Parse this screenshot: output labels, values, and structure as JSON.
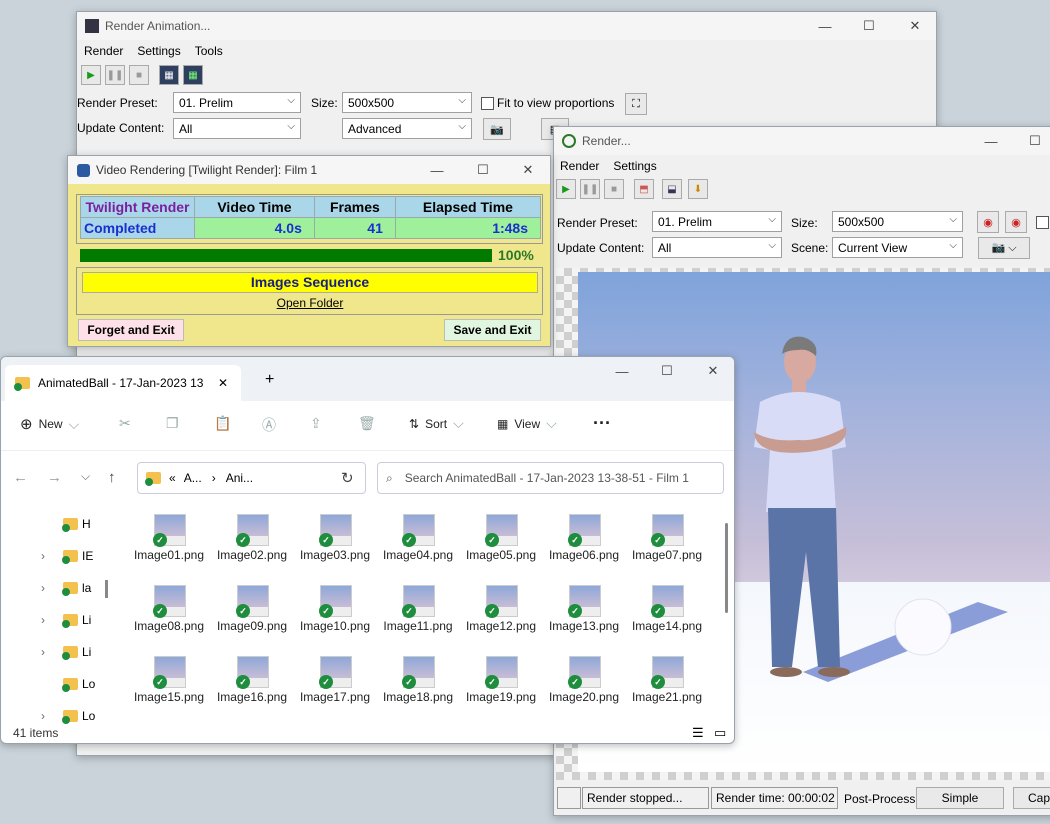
{
  "render_animation": {
    "title": "Render Animation...",
    "menu": [
      "Render",
      "Settings",
      "Tools"
    ],
    "render_preset_label": "Render Preset:",
    "render_preset": "01. Prelim",
    "size_label": "Size:",
    "size": "500x500",
    "fit_label": "Fit to view proportions",
    "update_content_label": "Update Content:",
    "update_content": "All",
    "advanced": "Advanced"
  },
  "render": {
    "title": "Render...",
    "menu": [
      "Render",
      "Settings"
    ],
    "render_preset_label": "Render Preset:",
    "render_preset": "01. Prelim",
    "size_label": "Size:",
    "size": "500x500",
    "update_content_label": "Update Content:",
    "update_content": "All",
    "scene_label": "Scene:",
    "scene": "Current View",
    "status_stopped": "Render stopped...",
    "render_time": "Render time: 00:00:02",
    "postprocess_label": "Post-Process:",
    "simple_button": "Simple",
    "cap_button": "Cap"
  },
  "video_rendering": {
    "title": "Video Rendering [Twilight Render]: Film 1",
    "headers": [
      "Twilight Render",
      "Video Time",
      "Frames",
      "Elapsed Time"
    ],
    "values": [
      "Completed",
      "4.0s",
      "41",
      "1:48s"
    ],
    "progress": 1.0,
    "progress_text": "100%",
    "images_sequence": "Images Sequence",
    "open_folder": "Open Folder",
    "forget_exit": "Forget and Exit",
    "save_exit": "Save and Exit"
  },
  "explorer": {
    "tab_title": "AnimatedBall - 17-Jan-2023 13",
    "new_label": "New",
    "sort_label": "Sort",
    "view_label": "View",
    "more_label": "···",
    "breadcrumb_prefix": "«",
    "breadcrumb_a": "A...",
    "breadcrumb_b": "Ani...",
    "search_placeholder": "Search AnimatedBall - 17-Jan-2023 13-38-51 - Film 1",
    "tree": [
      "H",
      "IE",
      "la",
      "Li",
      "Li",
      "Lo",
      "Lo"
    ],
    "files": [
      "Image01.png",
      "Image02.png",
      "Image03.png",
      "Image04.png",
      "Image05.png",
      "Image06.png",
      "Image07.png",
      "Image08.png",
      "Image09.png",
      "Image10.png",
      "Image11.png",
      "Image12.png",
      "Image13.png",
      "Image14.png",
      "Image15.png",
      "Image16.png",
      "Image17.png",
      "Image18.png",
      "Image19.png",
      "Image20.png",
      "Image21.png"
    ],
    "item_count": "41 items"
  },
  "colors": {
    "progress_green": "#007a00",
    "completed_blue": "#1a2fd0",
    "twilight_purple": "#7b1fa2",
    "cell_green": "#9ff09a",
    "cell_blue": "#a9d6e8",
    "images_yellow": "#ffff00"
  }
}
